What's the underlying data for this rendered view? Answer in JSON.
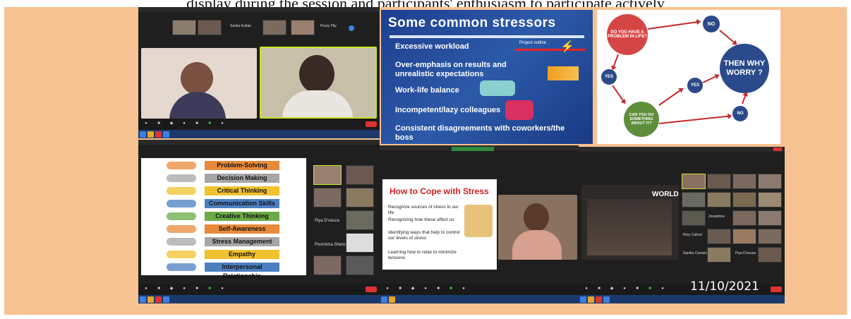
{
  "caption": "display during the session and participants' enthusiasm to participate actively",
  "panel1": {
    "participants": [
      "Sarika Kuttan",
      "Poory Pity"
    ]
  },
  "panel2": {
    "title": "Some common stressors",
    "bullets": [
      "Excessive workload",
      "Over-emphasis on results and unrealistic expectations",
      "Work-life balance",
      "Incompetent/lazy colleagues",
      "Consistent disagreements with coworkers/the boss"
    ],
    "tag": "Project outline"
  },
  "panel3": {
    "q1": "DO YOU HAVE A PROBLEM IN LIFE?",
    "q2": "CAN YOU DO SOMETHING ABOUT IT?",
    "yes": "YES",
    "no": "NO",
    "answer": "THEN WHY WORRY ?",
    "colors": {
      "red": "#d64545",
      "green": "#5e8e3a",
      "navy": "#2b4a8b"
    }
  },
  "panel4": {
    "skills": [
      {
        "label": "Problem-Solving",
        "color": "#e98a3a"
      },
      {
        "label": "Decision Making",
        "color": "#a6a6a6"
      },
      {
        "label": "Critical Thinking",
        "color": "#f2c12e"
      },
      {
        "label": "Communication Skills",
        "color": "#4c7fc2"
      },
      {
        "label": "Creative Thinking",
        "color": "#6aab45"
      },
      {
        "label": "Self-Awareness",
        "color": "#e98a3a"
      },
      {
        "label": "Stress Management",
        "color": "#a6a6a6"
      },
      {
        "label": "Empathy",
        "color": "#f2c12e"
      },
      {
        "label": "Interpersonal Relationship",
        "color": "#4c7fc2"
      }
    ],
    "names": [
      "Piya D'souza",
      "Poornima Shenoy"
    ]
  },
  "panel5": {
    "title": "How to Cope with Stress",
    "items": [
      "Recognize sources of stress in our life",
      "Recognizing how these affect us",
      "Identifying ways that help to control our levels of stress",
      "Learning how to relax to minimize tensions"
    ]
  },
  "panel6": {
    "world": "WORLD",
    "names": [
      "Josephine",
      "Rory Cabral",
      "Sanika Carneiro",
      "Piya D'souza"
    ]
  },
  "date": "11/10/2021"
}
